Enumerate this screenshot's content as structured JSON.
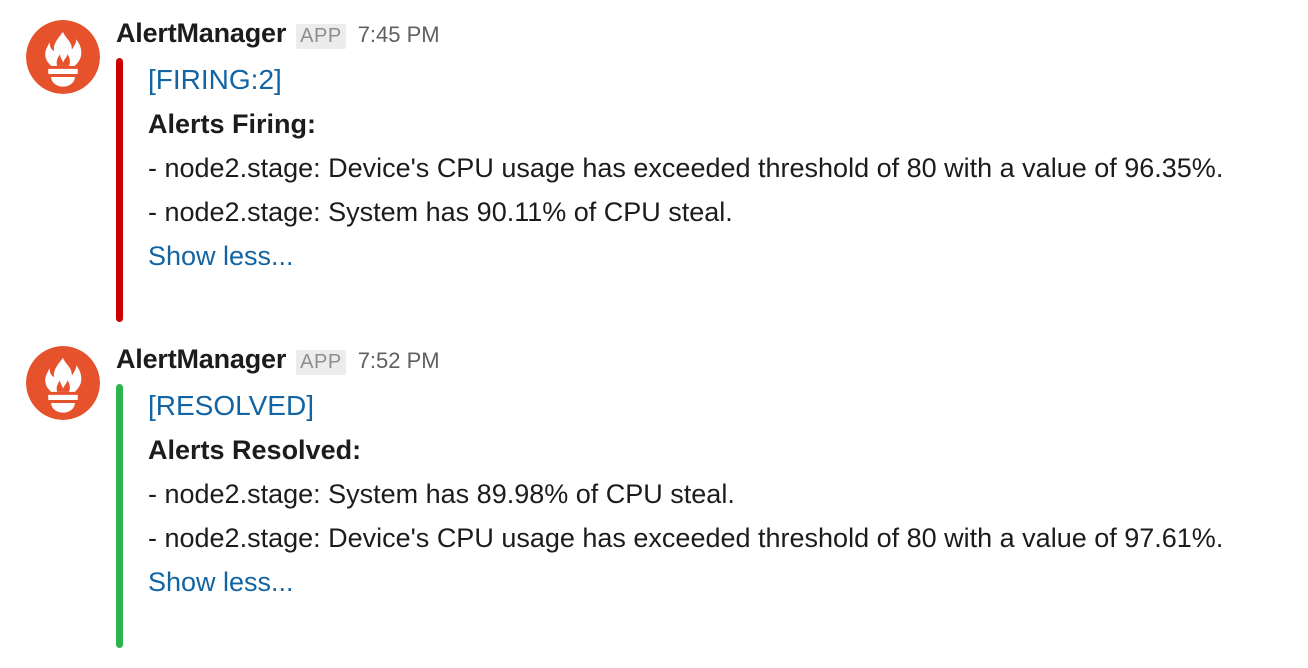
{
  "messages": [
    {
      "sender": "AlertManager",
      "badge": "APP",
      "time": "7:45 PM",
      "status_color": "#cc0000",
      "title": "[FIRING:2]",
      "heading": "Alerts Firing:",
      "lines": [
        "- node2.stage: Device's CPU usage has exceeded threshold of 80 with a value of 96.35%.",
        "- node2.stage: System has 90.11% of CPU steal."
      ],
      "show_less": "Show less..."
    },
    {
      "sender": "AlertManager",
      "badge": "APP",
      "time": "7:52 PM",
      "status_color": "#2eb44c",
      "title": "[RESOLVED]",
      "heading": "Alerts Resolved:",
      "lines": [
        "- node2.stage: System has 89.98% of CPU steal.",
        "- node2.stage: Device's CPU usage has exceeded threshold of 80 with a value of 97.61%."
      ],
      "show_less": "Show less..."
    }
  ],
  "icons": {
    "avatar": "prometheus-logo-icon"
  },
  "colors": {
    "avatar_bg": "#e6522c",
    "link": "#1264a3"
  }
}
